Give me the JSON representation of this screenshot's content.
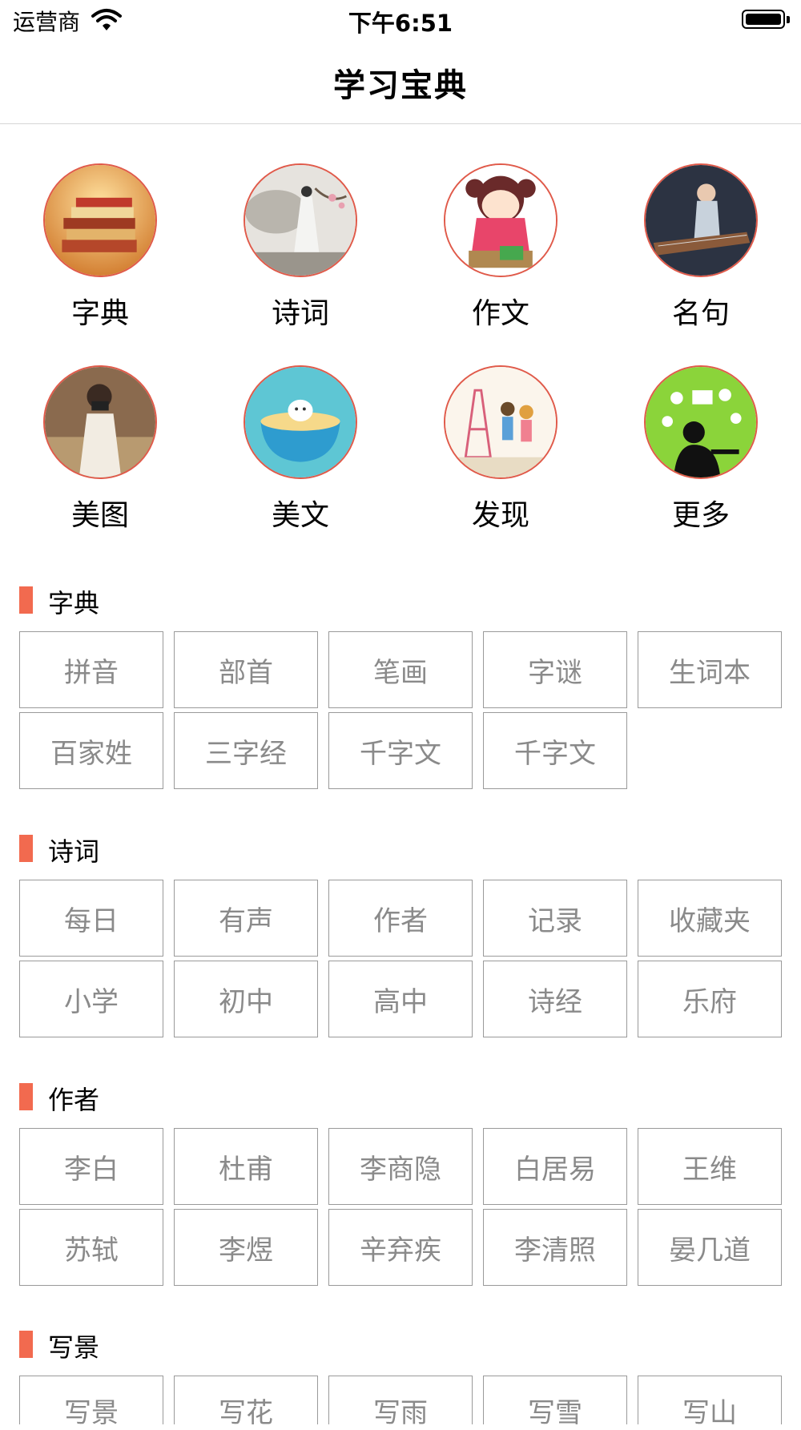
{
  "status_bar": {
    "carrier": "运营商",
    "time": "下午6:51"
  },
  "nav": {
    "title": "学习宝典"
  },
  "grid": [
    {
      "label": "字典"
    },
    {
      "label": "诗词"
    },
    {
      "label": "作文"
    },
    {
      "label": "名句"
    },
    {
      "label": "美图"
    },
    {
      "label": "美文"
    },
    {
      "label": "发现"
    },
    {
      "label": "更多"
    }
  ],
  "sections": [
    {
      "title": "字典",
      "items": [
        "拼音",
        "部首",
        "笔画",
        "字谜",
        "生词本",
        "百家姓",
        "三字经",
        "千字文",
        "千字文"
      ]
    },
    {
      "title": "诗词",
      "items": [
        "每日",
        "有声",
        "作者",
        "记录",
        "收藏夹",
        "小学",
        "初中",
        "高中",
        "诗经",
        "乐府"
      ]
    },
    {
      "title": "作者",
      "items": [
        "李白",
        "杜甫",
        "李商隐",
        "白居易",
        "王维",
        "苏轼",
        "李煜",
        "辛弃疾",
        "李清照",
        "晏几道"
      ]
    },
    {
      "title": "写景",
      "items": [
        "写景",
        "写花",
        "写雨",
        "写雪",
        "写山"
      ]
    }
  ]
}
